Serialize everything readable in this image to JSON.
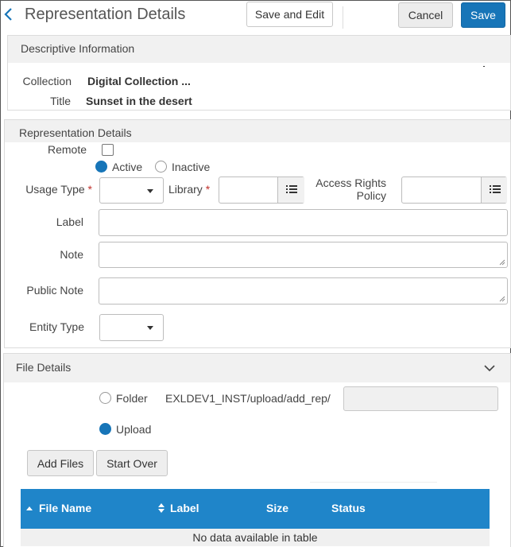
{
  "header": {
    "title": "Representation Details",
    "save_and_edit_label": "Save and Edit",
    "cancel_label": "Cancel",
    "save_label": "Save"
  },
  "descriptive": {
    "heading": "Descriptive Information",
    "collection_label": "Collection",
    "collection_value": "Digital Collection ...",
    "title_label": "Title",
    "title_value": "Sunset in the desert"
  },
  "rep_details": {
    "heading": "Representation Details",
    "remote_label": "Remote",
    "remote_checked": false,
    "status_options": [
      {
        "label": "Active",
        "selected": true
      },
      {
        "label": "Inactive",
        "selected": false
      }
    ],
    "usage_type_label": "Usage Type",
    "usage_type_value": "",
    "library_label": "Library",
    "library_value": "",
    "access_rights_label_1": "Access Rights",
    "access_rights_label_2": "Policy",
    "access_rights_value": "",
    "label_label": "Label",
    "label_value": "",
    "note_label": "Note",
    "note_value": "",
    "public_note_label": "Public Note",
    "public_note_value": "",
    "entity_type_label": "Entity Type",
    "entity_type_value": "",
    "required_marker": "*"
  },
  "file_details": {
    "heading": "File Details",
    "folder_label": "Folder",
    "folder_path": "EXLDEV1_INST/upload/add_rep/",
    "folder_input_value": "",
    "upload_label": "Upload",
    "upload_selected": true,
    "add_files_label": "Add Files",
    "start_over_label": "Start Over",
    "table": {
      "columns": [
        "File Name",
        "Label",
        "Size",
        "Status"
      ],
      "empty_text": "No data available in table"
    }
  },
  "colors": {
    "primary": "#1775b8",
    "table_header": "#1f85c9",
    "required": "#c0302b",
    "section_header_bg": "#f1f1f1"
  },
  "icons": [
    "back-chevron-icon",
    "list-icon",
    "chevron-down-icon",
    "sort-asc-icon",
    "sort-both-icon",
    "caret-down-icon"
  ]
}
